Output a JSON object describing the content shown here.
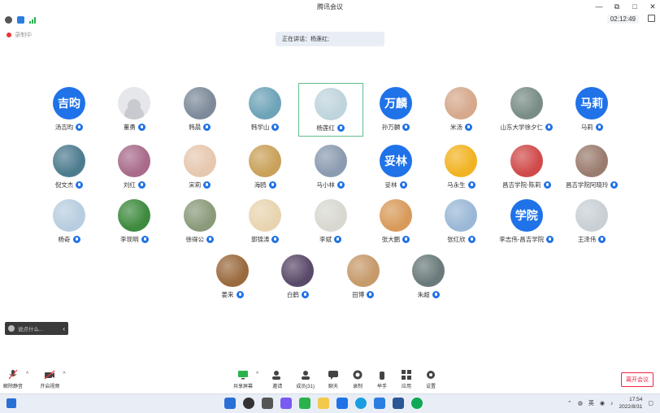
{
  "window": {
    "title": "腾讯会议",
    "controls": [
      "—",
      "⧉",
      "□",
      "✕"
    ]
  },
  "infobar": {
    "timer": "02:12:49"
  },
  "recording": {
    "label": "录制中"
  },
  "speaking": {
    "text": "正在讲话：杨莲红;"
  },
  "participants": [
    {
      "name": "汤吉昀",
      "avatar_text": "吉昀",
      "avatar": "text"
    },
    {
      "name": "董勇",
      "avatar_text": "",
      "avatar": "default"
    },
    {
      "name": "韩晨",
      "avatar_text": "",
      "avatar": "photo",
      "color": "#7d8a9a"
    },
    {
      "name": "韩学山",
      "avatar_text": "",
      "avatar": "photo",
      "color": "#6ea3b8"
    },
    {
      "name": "杨莲红",
      "avatar_text": "",
      "avatar": "photo",
      "color": "#bfd4dc",
      "selected": true
    },
    {
      "name": "孙万麟",
      "avatar_text": "万麟",
      "avatar": "text"
    },
    {
      "name": "米汤",
      "avatar_text": "",
      "avatar": "photo",
      "color": "#d6a88c"
    },
    {
      "name": "山东大学徐夕仁",
      "avatar_text": "",
      "avatar": "photo",
      "color": "#7a8c86"
    },
    {
      "name": "马莉",
      "avatar_text": "马莉",
      "avatar": "text"
    },
    {
      "name": "倪文杰",
      "avatar_text": "",
      "avatar": "photo",
      "color": "#4d7c8f"
    },
    {
      "name": "刘红",
      "avatar_text": "",
      "avatar": "photo",
      "color": "#a86b8a"
    },
    {
      "name": "宋莉",
      "avatar_text": "",
      "avatar": "photo",
      "color": "#e6c8b0"
    },
    {
      "name": "海鸥",
      "avatar_text": "",
      "avatar": "photo",
      "color": "#c9a15a"
    },
    {
      "name": "马小林",
      "avatar_text": "",
      "avatar": "photo",
      "color": "#8b9bb0"
    },
    {
      "name": "妥林",
      "avatar_text": "妥林",
      "avatar": "text"
    },
    {
      "name": "马永生",
      "avatar_text": "",
      "avatar": "photo",
      "color": "#f2b322"
    },
    {
      "name": "昌吉学院-陈莉",
      "avatar_text": "",
      "avatar": "photo",
      "color": "#d04a4a"
    },
    {
      "name": "昌吉学院阿晓玲",
      "avatar_text": "",
      "avatar": "photo",
      "color": "#9a7c6e"
    },
    {
      "name": "杨奇",
      "avatar_text": "",
      "avatar": "photo",
      "color": "#b8cde0"
    },
    {
      "name": "李现明",
      "avatar_text": "",
      "avatar": "photo",
      "color": "#3e8a3e"
    },
    {
      "name": "徐得公",
      "avatar_text": "",
      "avatar": "photo",
      "color": "#8a9a7a"
    },
    {
      "name": "郭锦涛",
      "avatar_text": "",
      "avatar": "photo",
      "color": "#e8d4b0"
    },
    {
      "name": "李斌",
      "avatar_text": "",
      "avatar": "photo",
      "color": "#d8d8d0"
    },
    {
      "name": "张大鹏",
      "avatar_text": "",
      "avatar": "photo",
      "color": "#d89a5a"
    },
    {
      "name": "张红欣",
      "avatar_text": "",
      "avatar": "photo",
      "color": "#9ab8d6"
    },
    {
      "name": "李志伟-昌吉学院",
      "avatar_text": "学院",
      "avatar": "text"
    },
    {
      "name": "王泽伟",
      "avatar_text": "",
      "avatar": "photo",
      "color": "#c8d0d6"
    },
    {
      "name": "姜来",
      "avatar_text": "",
      "avatar": "photo",
      "color": "#9a6a3e"
    },
    {
      "name": "白鹤",
      "avatar_text": "",
      "avatar": "photo",
      "color": "#5a4a6a"
    },
    {
      "name": "田博",
      "avatar_text": "",
      "avatar": "photo",
      "color": "#c69a6a"
    },
    {
      "name": "朱超",
      "avatar_text": "",
      "avatar": "photo",
      "color": "#6a7a7a"
    }
  ],
  "chat": {
    "placeholder": "说点什么..."
  },
  "toolbar": {
    "left": [
      {
        "label": "解除静音",
        "icon": "mic-muted-icon"
      },
      {
        "label": "开启视频",
        "icon": "camera-off-icon"
      }
    ],
    "center": [
      {
        "label": "共享屏幕",
        "icon": "share-screen-icon"
      },
      {
        "label": "邀请",
        "icon": "invite-icon"
      },
      {
        "label": "成员(31)",
        "icon": "members-icon"
      },
      {
        "label": "聊天",
        "icon": "chat-icon"
      },
      {
        "label": "录制",
        "icon": "record-icon"
      },
      {
        "label": "举手",
        "icon": "raise-hand-icon"
      },
      {
        "label": "应用",
        "icon": "apps-icon"
      },
      {
        "label": "设置",
        "icon": "settings-icon"
      }
    ],
    "leave": "离开会议"
  },
  "taskbar": {
    "time": "17:54",
    "date": "2022/8/31",
    "ime": "英"
  },
  "colors": {
    "accent": "#1f72e8",
    "leave": "#e22244",
    "selected": "#5fbf8e"
  }
}
